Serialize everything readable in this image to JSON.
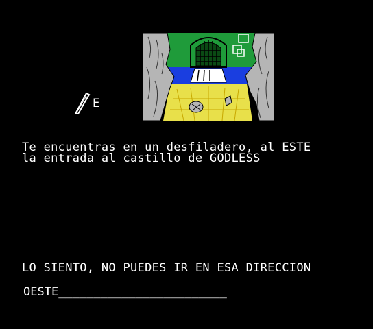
{
  "game": {
    "description_line1": "Te encuentras en un desfiladero, al ESTE",
    "description_line2": "la entrada al castillo de GODLESS",
    "response": "LO SIENTO, NO PUEDES IR EN ESA DIRECCION",
    "input_text": "OESTE",
    "input_cursor": "________________________",
    "compass_direction": "E"
  },
  "colors": {
    "background": "#000000",
    "text": "#ffffff",
    "rock": "#b5b5b5",
    "grass": "#1f9b3a",
    "water": "#1a3ee0",
    "path": "#e8e04a",
    "gate": "#ffffff"
  },
  "icons": {
    "compass": "feather-pen-icon"
  }
}
